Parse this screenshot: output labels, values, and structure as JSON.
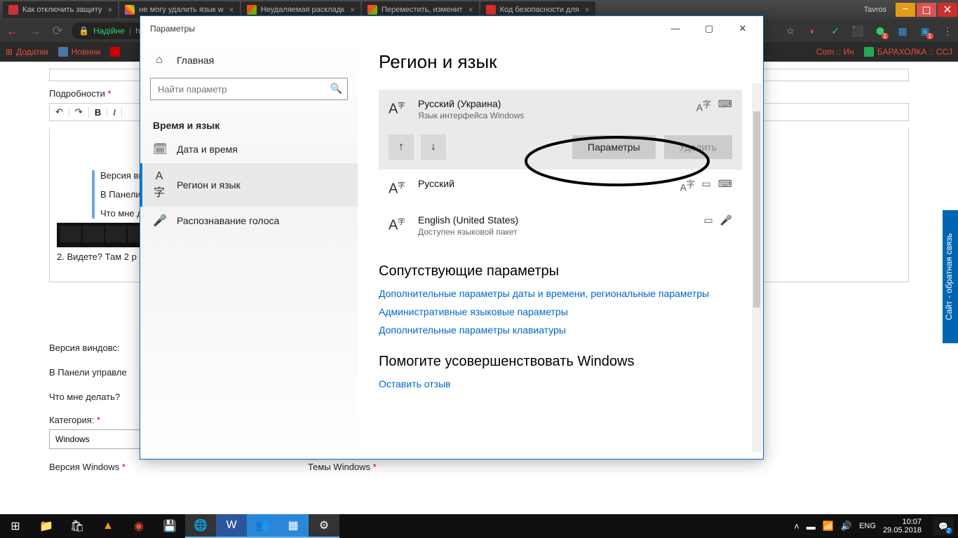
{
  "titlebar_user": "Tavros",
  "tabs": [
    {
      "label": "Как отключить защиту",
      "fav": "yt"
    },
    {
      "label": "не могу удалить язык w",
      "fav": "g"
    },
    {
      "label": "Неудаляемая раскладк",
      "fav": "w"
    },
    {
      "label": "Переместить, изменит",
      "fav": "w"
    },
    {
      "label": "Код безопасности для",
      "fav": "m"
    }
  ],
  "addr": {
    "secure": "Надійне",
    "url": "ht"
  },
  "bookmarks": {
    "apps": "Додатки",
    "news": "Новини",
    "right1": "Com :: Ин",
    "right2": "БАРАХОЛКА :: CCJ"
  },
  "page": {
    "details": "Подробности",
    "req": "*",
    "q1": "Версия виндо",
    "q2": "В Панели упра",
    "q3": "Что мне делат",
    "line2": "2. Видете? Там 2 р",
    "pv1": "Версия виндовс:",
    "pv2": "В Панели управле",
    "pv3": "Что мне делать?",
    "category": "Категория:",
    "cat_val": "Windows",
    "ver": "Версия Windows",
    "themes": "Темы Windows"
  },
  "feedback": "Сайт - обратная связь",
  "settings": {
    "title": "Параметры",
    "nav": {
      "home": "Главная",
      "search": "Найти параметр",
      "group": "Время и язык",
      "date": "Дата и время",
      "region": "Регион и язык",
      "speech": "Распознавание голоса"
    },
    "content": {
      "heading": "Регион и язык",
      "langs": [
        {
          "name": "Русский (Украина)",
          "sub": "Язык интерфейса Windows"
        },
        {
          "name": "Русский",
          "sub": ""
        },
        {
          "name": "English (United States)",
          "sub": "Доступен языковой пакет"
        }
      ],
      "btn_params": "Параметры",
      "btn_delete": "Удалить",
      "related": "Сопутствующие параметры",
      "link1": "Дополнительные параметры даты и времени, региональные параметры",
      "link2": "Административные языковые параметры",
      "link3": "Дополнительные параметры клавиатуры",
      "improve": "Помогите усовершенствовать Windows",
      "leave": "Оставить отзыв"
    }
  },
  "taskbar": {
    "lang": "ENG",
    "time": "10:07",
    "date": "29.05.2018",
    "notif": "2"
  }
}
